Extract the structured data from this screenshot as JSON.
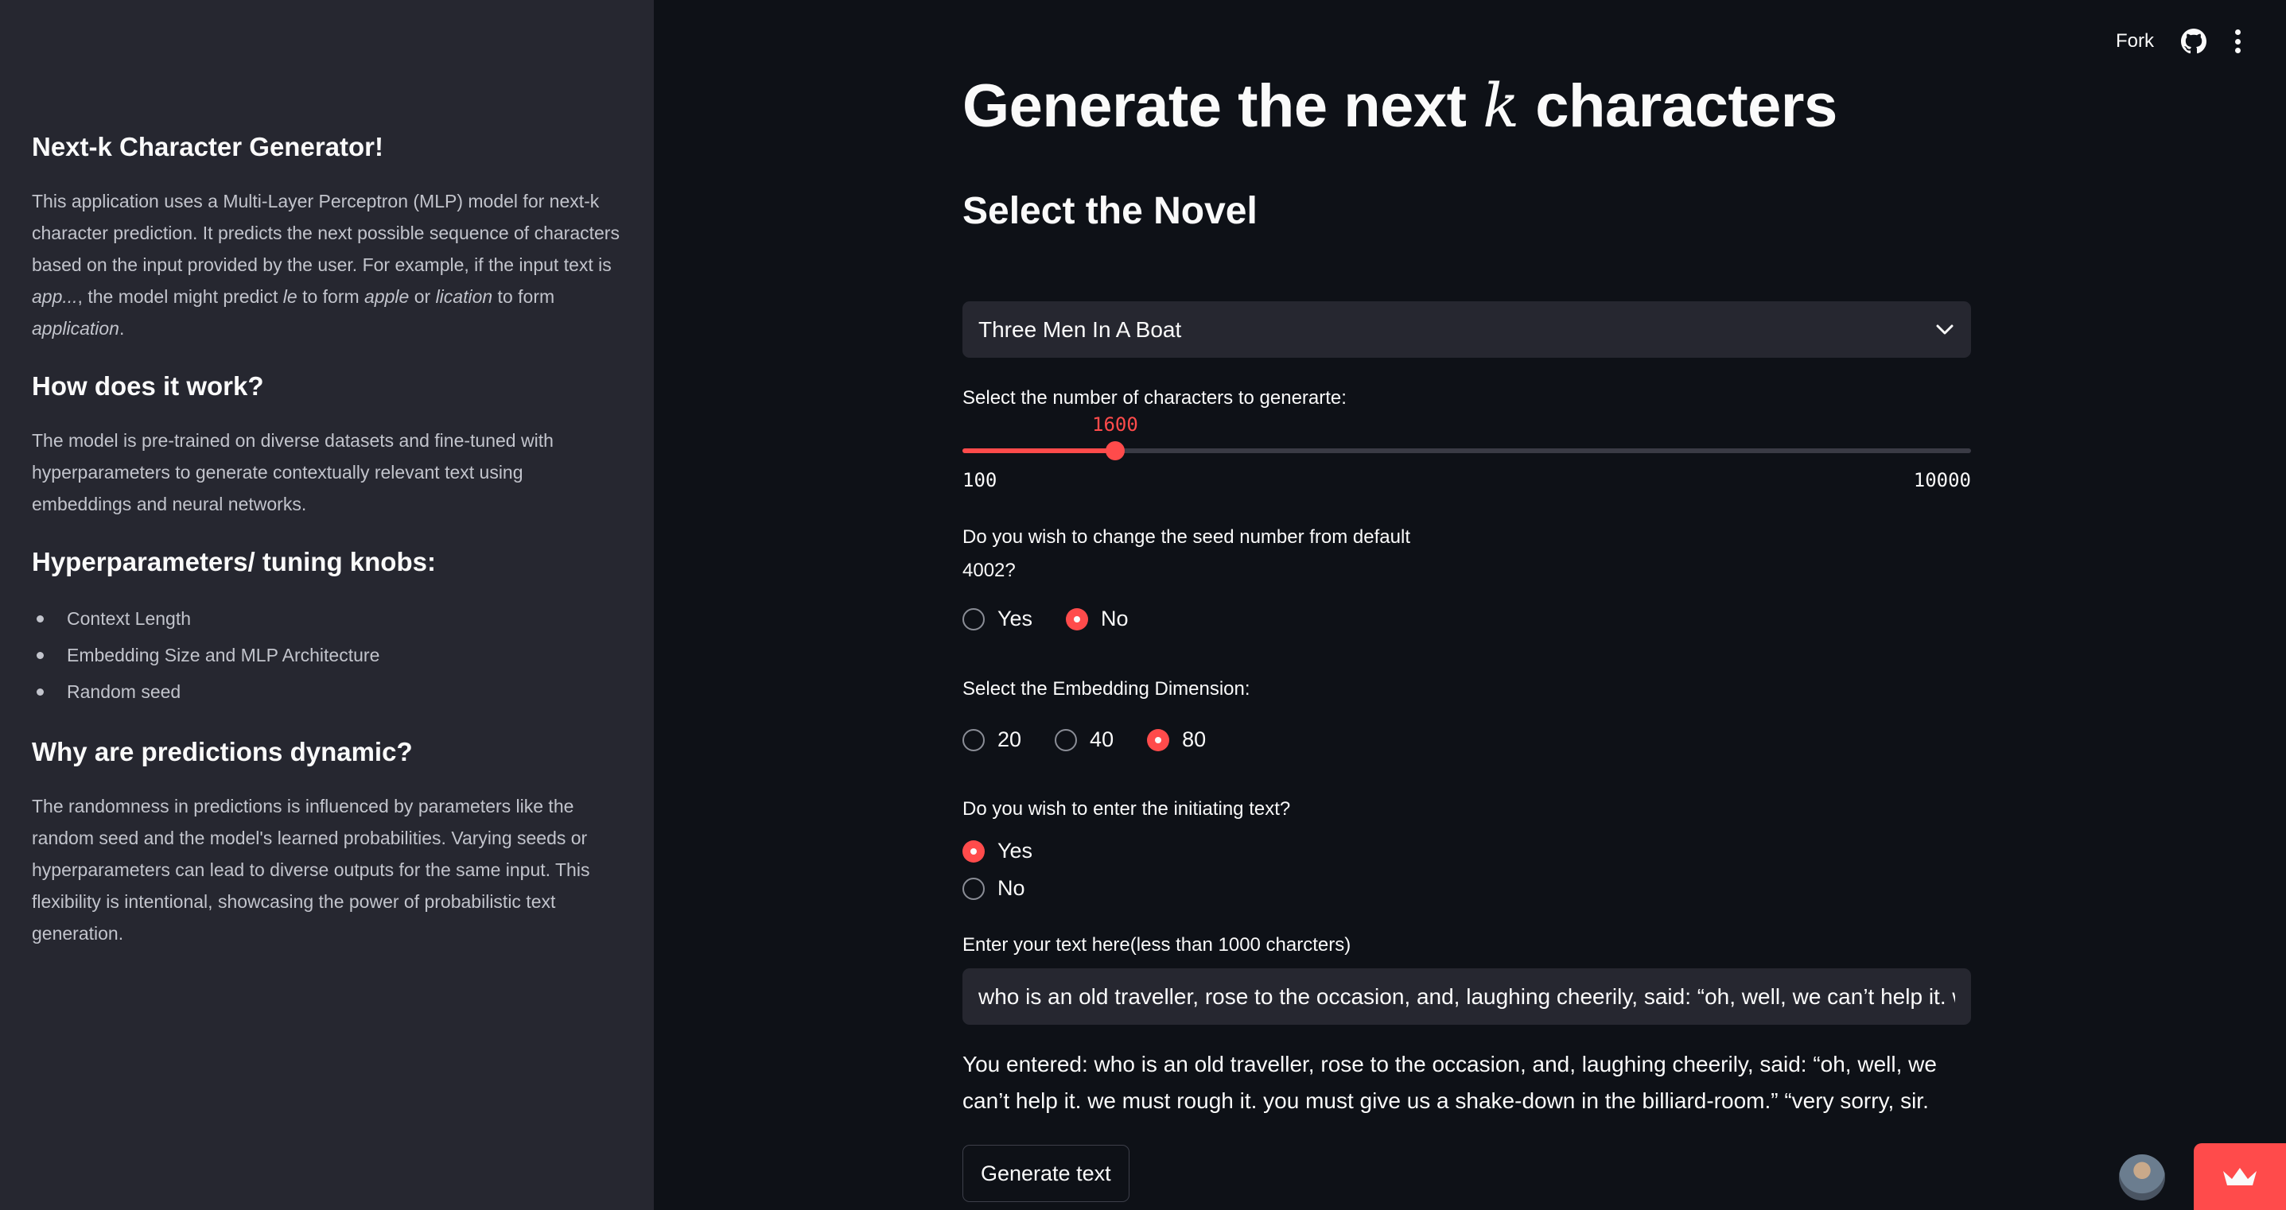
{
  "header": {
    "fork_label": "Fork",
    "github_icon": "github-icon",
    "menu_icon": "kebab-menu-icon"
  },
  "sidebar": {
    "title": "Next-k Character Generator!",
    "intro": {
      "p1": "This application uses a Multi-Layer Perceptron (MLP) model for next-k character prediction. It predicts the next possible sequence of characters based on the input provided by the user. For example, if the input text is ",
      "em1": "app...",
      "p2": ", the model might predict ",
      "em2": "le",
      "p3": " to form ",
      "em3": "apple",
      "p4": " or ",
      "em4": "lication",
      "p5": " to form ",
      "em5": "application",
      "p6": "."
    },
    "how_title": "How does it work?",
    "how_text": "The model is pre-trained on diverse datasets and fine-tuned with hyperparameters to generate contextually relevant text using embeddings and neural networks.",
    "hyper_title": "Hyperparameters/ tuning knobs:",
    "hyper_items": [
      "Context Length",
      "Embedding Size and MLP Architecture",
      "Random seed"
    ],
    "why_title": "Why are predictions dynamic?",
    "why_text": "The randomness in predictions is influenced by parameters like the random seed and the model's learned probabilities. Varying seeds or hyperparameters can lead to diverse outputs for the same input. This flexibility is intentional, showcasing the power of probabilistic text generation."
  },
  "main": {
    "title_before": "Generate the next ",
    "title_k": "k",
    "title_after": " characters",
    "section_title": "Select the Novel",
    "novel_selected": "Three Men In A Boat",
    "slider": {
      "label": "Select the number of characters to generarte:",
      "value": "1600",
      "value_num": 1600,
      "min": "100",
      "max": "10000",
      "min_num": 100,
      "max_num": 10000
    },
    "seed": {
      "label": "Do you wish to change the seed number from default 4002?",
      "options": [
        "Yes",
        "No"
      ],
      "selected": 1
    },
    "embedding": {
      "label": "Select the Embedding Dimension:",
      "options": [
        "20",
        "40",
        "80"
      ],
      "selected": 2
    },
    "init_text": {
      "label": "Do you wish to enter the initiating text?",
      "options": [
        "Yes",
        "No"
      ],
      "selected": 0
    },
    "text_input": {
      "label": "Enter your text here(less than 1000 charcters)",
      "value": "who is an old traveller, rose to the occasion, and, laughing cheerily, said: “oh, well, we can’t help it. we must rough it. you must give us a shake-down in the billiard-room.” “very sorry, sir."
    },
    "entered": "You entered: who is an old traveller, rose to the occasion, and, laughing cheerily, said: “oh, well, we can’t help it. we must rough it. you must give us a shake-down in the billiard-room.” “very sorry, sir.",
    "generate_label": "Generate text"
  },
  "colors": {
    "accent": "#ff4b4b",
    "background": "#0e1117",
    "sidebar": "#262730"
  }
}
